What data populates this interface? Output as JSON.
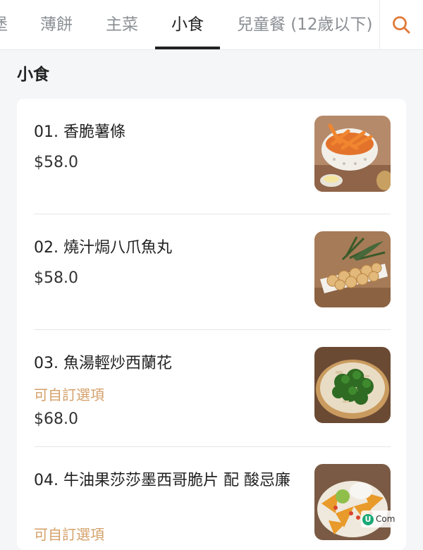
{
  "tabs": [
    {
      "label": "堡"
    },
    {
      "label": "薄餅"
    },
    {
      "label": "主菜"
    },
    {
      "label": "小食"
    },
    {
      "label": "兒童餐 (12歲以下)"
    }
  ],
  "active_tab": "小食",
  "section": {
    "title": "小食"
  },
  "items": [
    {
      "name": "01. 香脆薯條",
      "option": "",
      "price": "$58.0",
      "image": "fries-thumbnail"
    },
    {
      "name": "02. 燒汁焗八爪魚丸",
      "option": "",
      "price": "$58.0",
      "image": "octopus-balls-thumbnail"
    },
    {
      "name": "03. 魚湯輕炒西蘭花",
      "option": "可自訂選項",
      "price": "$68.0",
      "image": "broccoli-thumbnail"
    },
    {
      "name": "04. 牛油果莎莎墨西哥脆片 配 酸忌廉",
      "option": "可自訂選項",
      "price": "",
      "image": "nachos-thumbnail"
    }
  ],
  "watermark": {
    "logo": "U",
    "text": "Com"
  },
  "colors": {
    "accent": "#e07a3a",
    "option": "#d4a06a"
  },
  "icons": {
    "search": "search-icon"
  }
}
